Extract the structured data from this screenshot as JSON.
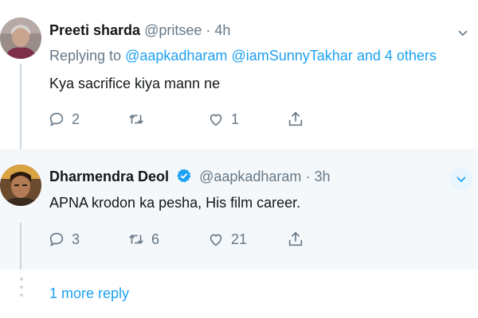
{
  "tweets": [
    {
      "author_name": "Preeti sharda",
      "handle": "@pritsee",
      "dot": "·",
      "time": "4h",
      "replying_prefix": "Replying to",
      "replying_mention_1": "@aapkadharam",
      "replying_mention_2": "@iamSunnyTakhar",
      "replying_others": "and 4 others",
      "text": "Kya sacrifice kiya mann ne",
      "reply_count": "2",
      "retweet_count": "",
      "like_count": "1"
    },
    {
      "author_name": "Dharmendra Deol",
      "handle": "@aapkadharam",
      "dot": "·",
      "time": "3h",
      "text": "APNA krodon ka pesha, His film career.",
      "reply_count": "3",
      "retweet_count": "6",
      "like_count": "21"
    }
  ],
  "more_replies_label": "1 more reply",
  "colors": {
    "accent": "#1da1f2",
    "secondary_text": "#657786",
    "thread_line": "#ccd6dd",
    "highlight_bg": "#f5f8fa"
  },
  "icons": [
    "reply-icon",
    "retweet-icon",
    "like-icon",
    "share-icon",
    "chevron-down-icon",
    "verified-badge-icon"
  ]
}
